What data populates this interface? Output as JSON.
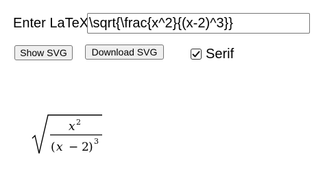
{
  "form": {
    "label": "Enter LaTeX",
    "latex_value": "\\sqrt{\\frac{x^2}{(x-2)^3}}"
  },
  "buttons": {
    "show_svg": "Show SVG",
    "download_svg": "Download SVG"
  },
  "serif_option": {
    "label": "Serif",
    "checked": true
  },
  "rendered_math": {
    "numerator_base": "x",
    "numerator_exponent": "2",
    "denominator_open": "(",
    "denominator_base": "x",
    "denominator_operator": "−",
    "denominator_number": "2",
    "denominator_close": ")",
    "denominator_exponent": "3"
  }
}
